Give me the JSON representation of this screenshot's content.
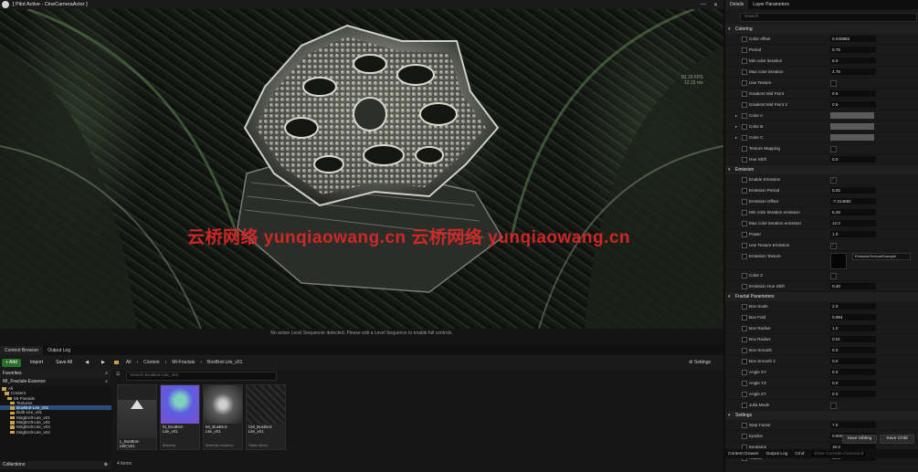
{
  "viewport": {
    "title": "[ Pilot Active - CineCameraActor ]",
    "fps_lines": [
      "82.29 FPS",
      "12.15 ms"
    ],
    "message": "No active Level Sequencer detected. Please edit a Level Sequence to enable full controls."
  },
  "watermark": "云桥网络 yunqiaowang.cn 云桥网络 yunqiaowang.cn",
  "content_browser": {
    "tabs": [
      "Content Browser",
      "Output Log"
    ],
    "add_label": "+ Add",
    "import_label": "Import",
    "save_all_label": "Save All",
    "breadcrumbs": [
      "All",
      "Content",
      "MI-Fractals",
      "BoxBrot-Lite_v01"
    ],
    "settings_label": "Settings",
    "favorites_label": "Favorites",
    "project_label": "MI_Fractals-Essence",
    "tree": [
      {
        "label": "All",
        "indent": 0
      },
      {
        "label": "Content",
        "indent": 1
      },
      {
        "label": "MI-Fractals",
        "indent": 2
      },
      {
        "label": "Textures",
        "indent": 3
      },
      {
        "label": "BoxBrot-Lite_v01",
        "indent": 3,
        "selected": true
      },
      {
        "label": "Bulb-Lite_v01",
        "indent": 3
      },
      {
        "label": "Mirgbrolt-Lite_v01",
        "indent": 3
      },
      {
        "label": "Mirgbrolt-Lite_v02",
        "indent": 3
      },
      {
        "label": "Mirgbrolt-Lite_v03",
        "indent": 3
      },
      {
        "label": "Mirgbrolt-Lite_v04",
        "indent": 3
      }
    ],
    "collections_label": "Collections",
    "search_placeholder": "Search BoxBrot-Lite_v01",
    "assets": [
      {
        "name": "L_BoxBrot-Lite_v01",
        "type": "Level",
        "thumb": "level"
      },
      {
        "name": "M_BoxBrot-Lite_v01",
        "type": "Material",
        "thumb": "material"
      },
      {
        "name": "MI_BoxBrot-Lite_v01",
        "type": "Material Instance",
        "thumb": "instance"
      },
      {
        "name": "CM_BoxBrot-Lite_v01",
        "type": "Static Mesh",
        "thumb": "mesh"
      }
    ],
    "item_count": "4 items"
  },
  "details": {
    "tabs": [
      "Details",
      "Layer Parameters"
    ],
    "search_placeholder": "Search",
    "categories": [
      {
        "name": "Coloring",
        "rows": [
          {
            "label": "Color offset",
            "kind": "value",
            "value": "0.040882"
          },
          {
            "label": "Period",
            "kind": "value",
            "value": "0.76"
          },
          {
            "label": "Min color iteration",
            "kind": "value",
            "value": "6.0"
          },
          {
            "label": "Max color iteration",
            "kind": "value",
            "value": "4.75"
          },
          {
            "label": "Use Texture",
            "kind": "check",
            "on": false
          },
          {
            "label": "Gradient Mid Point",
            "kind": "value",
            "value": "0.5"
          },
          {
            "label": "Gradient Mid Point 2",
            "kind": "value",
            "value": "0.5"
          },
          {
            "label": "Color A",
            "kind": "swatch",
            "expand": true
          },
          {
            "label": "Color B",
            "kind": "swatch",
            "expand": true
          },
          {
            "label": "Color C",
            "kind": "swatch",
            "expand": true
          },
          {
            "label": "Texture Mapping",
            "kind": "check",
            "on": false
          },
          {
            "label": "Hue Shift",
            "kind": "value",
            "value": "0.0"
          }
        ]
      },
      {
        "name": "Emission",
        "rows": [
          {
            "label": "Enable Emission",
            "kind": "check",
            "on": true
          },
          {
            "label": "Emission Period",
            "kind": "value",
            "value": "0.02"
          },
          {
            "label": "Emission Offset",
            "kind": "value",
            "value": "-7.314682"
          },
          {
            "label": "Min color iteration emission",
            "kind": "value",
            "value": "5.26"
          },
          {
            "label": "Max color iteration emission",
            "kind": "value",
            "value": "12.0"
          },
          {
            "label": "Power",
            "kind": "value",
            "value": "1.0"
          },
          {
            "label": "Use Texture Emission",
            "kind": "check",
            "on": true
          },
          {
            "label": "Emission Texture",
            "kind": "texture",
            "value": "EmissionTextureExample"
          },
          {
            "label": "Color 2",
            "kind": "check",
            "on": false
          },
          {
            "label": "Emission Hue Shift",
            "kind": "value",
            "value": "0.40"
          }
        ]
      },
      {
        "name": "Fractal Parameters",
        "rows": [
          {
            "label": "Box Scale",
            "kind": "value",
            "value": "2.0"
          },
          {
            "label": "Box Fold",
            "kind": "value",
            "value": "0.984"
          },
          {
            "label": "Box Radius",
            "kind": "value",
            "value": "1.0"
          },
          {
            "label": "Box Radius",
            "kind": "value",
            "value": "0.01"
          },
          {
            "label": "Box Smooth",
            "kind": "value",
            "value": "0.0"
          },
          {
            "label": "Box Smooth 2",
            "kind": "value",
            "value": "0.0"
          },
          {
            "label": "Angle XY",
            "kind": "value",
            "value": "0.0"
          },
          {
            "label": "Angle YZ",
            "kind": "value",
            "value": "0.0"
          },
          {
            "label": "Angle ZY",
            "kind": "value",
            "value": "0.0"
          },
          {
            "label": "Julia Mode",
            "kind": "check",
            "on": false
          }
        ]
      },
      {
        "name": "Settings",
        "rows": [
          {
            "label": "Step Factor",
            "kind": "value",
            "value": "7.0"
          },
          {
            "label": "Epsilon",
            "kind": "value",
            "value": "0.0005"
          },
          {
            "label": "Iterations",
            "kind": "value",
            "value": "16.0"
          },
          {
            "label": "Radius",
            "kind": "value",
            "value": "90.0"
          }
        ]
      }
    ],
    "save_sibling_label": "Save Sibling",
    "save_child_label": "Save Child"
  },
  "statusbar": {
    "content_drawer": "Content Drawer",
    "output_log": "Output Log",
    "cmd": "Cmd",
    "console_placeholder": "Enter Console Command"
  }
}
